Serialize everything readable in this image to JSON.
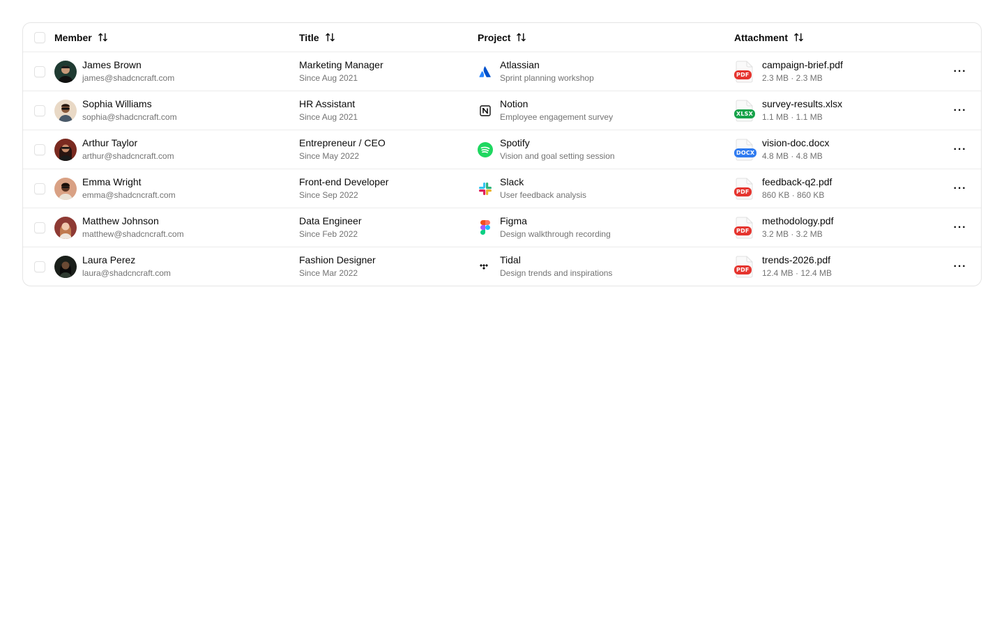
{
  "columns": {
    "member": "Member",
    "title": "Title",
    "project": "Project",
    "attachment": "Attachment"
  },
  "rows": [
    {
      "member": {
        "name": "James Brown",
        "email": "james@shadcncraft.com"
      },
      "title": {
        "role": "Marketing Manager",
        "since": "Since Aug 2021"
      },
      "project": {
        "name": "Atlassian",
        "description": "Sprint planning workshop",
        "icon": "atlassian-icon"
      },
      "attachment": {
        "file": "campaign-brief.pdf",
        "size": "2.3 MB · 2.3 MB",
        "type": "PDF",
        "color": "#e5342e"
      }
    },
    {
      "member": {
        "name": "Sophia Williams",
        "email": "sophia@shadcncraft.com"
      },
      "title": {
        "role": "HR Assistant",
        "since": "Since Aug 2021"
      },
      "project": {
        "name": "Notion",
        "description": "Employee engagement survey",
        "icon": "notion-icon"
      },
      "attachment": {
        "file": "survey-results.xlsx",
        "size": "1.1 MB · 1.1 MB",
        "type": "XLSX",
        "color": "#16a34a"
      }
    },
    {
      "member": {
        "name": "Arthur Taylor",
        "email": "arthur@shadcncraft.com"
      },
      "title": {
        "role": "Entrepreneur / CEO",
        "since": "Since May 2022"
      },
      "project": {
        "name": "Spotify",
        "description": "Vision and goal setting session",
        "icon": "spotify-icon"
      },
      "attachment": {
        "file": "vision-doc.docx",
        "size": "4.8 MB · 4.8 MB",
        "type": "DOCX",
        "color": "#2f7bf0"
      }
    },
    {
      "member": {
        "name": "Emma Wright",
        "email": "emma@shadcncraft.com"
      },
      "title": {
        "role": "Front-end Developer",
        "since": "Since Sep 2022"
      },
      "project": {
        "name": "Slack",
        "description": "User feedback analysis",
        "icon": "slack-icon"
      },
      "attachment": {
        "file": "feedback-q2.pdf",
        "size": "860 KB · 860 KB",
        "type": "PDF",
        "color": "#e5342e"
      }
    },
    {
      "member": {
        "name": "Matthew Johnson",
        "email": "matthew@shadcncraft.com"
      },
      "title": {
        "role": "Data Engineer",
        "since": "Since Feb 2022"
      },
      "project": {
        "name": "Figma",
        "description": "Design walkthrough recording",
        "icon": "figma-icon"
      },
      "attachment": {
        "file": "methodology.pdf",
        "size": "3.2 MB · 3.2 MB",
        "type": "PDF",
        "color": "#e5342e"
      }
    },
    {
      "member": {
        "name": "Laura Perez",
        "email": "laura@shadcncraft.com"
      },
      "title": {
        "role": "Fashion Designer",
        "since": "Since Mar 2022"
      },
      "project": {
        "name": "Tidal",
        "description": "Design trends and inspirations",
        "icon": "tidal-icon"
      },
      "attachment": {
        "file": "trends-2026.pdf",
        "size": "12.4 MB · 12.4 MB",
        "type": "PDF",
        "color": "#e5342e"
      }
    }
  ],
  "actions_label": "···"
}
